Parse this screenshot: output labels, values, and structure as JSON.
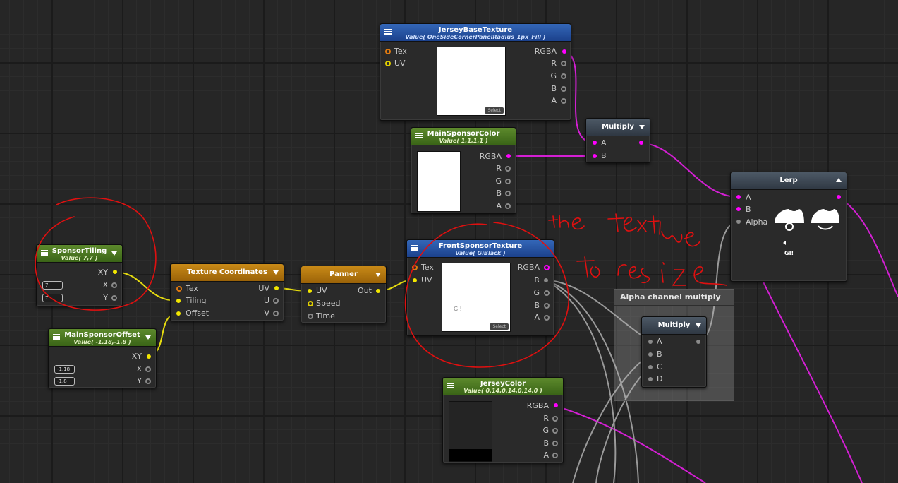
{
  "nodes": {
    "jersey_base_texture": {
      "title": "JerseyBaseTexture",
      "subtitle": "Value( OneSideCornerPanelRadius_1px_Fill )",
      "inputs": [
        "Tex",
        "UV"
      ],
      "outputs": [
        "RGBA",
        "R",
        "G",
        "B",
        "A"
      ],
      "select_label": "Select"
    },
    "multiply_top": {
      "title": "Multiply",
      "inputs": [
        "A",
        "B"
      ]
    },
    "main_sponsor_color": {
      "title": "MainSponsorColor",
      "subtitle": "Value( 1,1,1,1 )",
      "outputs": [
        "RGBA",
        "R",
        "G",
        "B",
        "A"
      ]
    },
    "lerp": {
      "title": "Lerp",
      "inputs": [
        "A",
        "B",
        "Alpha"
      ],
      "preview_text": "GI!"
    },
    "sponsor_tiling": {
      "title": "SponsorTiling",
      "subtitle": "Value( 7,7 )",
      "outputs": [
        "XY",
        "X",
        "Y"
      ],
      "x_value": "7",
      "y_value": "7"
    },
    "texture_coordinates": {
      "title": "Texture Coordinates",
      "inputs": [
        "Tex",
        "Tiling",
        "Offset"
      ],
      "outputs": [
        "UV",
        "U",
        "V"
      ]
    },
    "panner": {
      "title": "Panner",
      "inputs": [
        "UV",
        "Speed",
        "Time"
      ],
      "output": "Out"
    },
    "front_sponsor_texture": {
      "title": "FrontSponsorTexture",
      "subtitle": "Value( GiBlack )",
      "inputs": [
        "Tex",
        "UV"
      ],
      "outputs": [
        "RGBA",
        "R",
        "G",
        "B",
        "A"
      ],
      "preview_text": "GI!",
      "select_label": "Select"
    },
    "main_sponsor_offset": {
      "title": "MainSponsorOffset",
      "subtitle": "Value( -1.18,-1.8 )",
      "outputs": [
        "XY",
        "X",
        "Y"
      ],
      "x_value": "-1.18",
      "y_value": "-1.8"
    },
    "alpha_group": {
      "title": "Alpha channel multiply"
    },
    "multiply_inner": {
      "title": "Multiply",
      "inputs": [
        "A",
        "B",
        "C",
        "D"
      ]
    },
    "jersey_color": {
      "title": "JerseyColor",
      "subtitle": "Value( 0.14,0.14,0.14,0 )",
      "outputs": [
        "RGBA",
        "R",
        "G",
        "B",
        "A"
      ]
    }
  },
  "colors": {
    "wire_magenta": "#d41fd4",
    "wire_yellow": "#e6dc10",
    "wire_gray": "#9a9a9a",
    "annotation_red": "#e01010"
  }
}
